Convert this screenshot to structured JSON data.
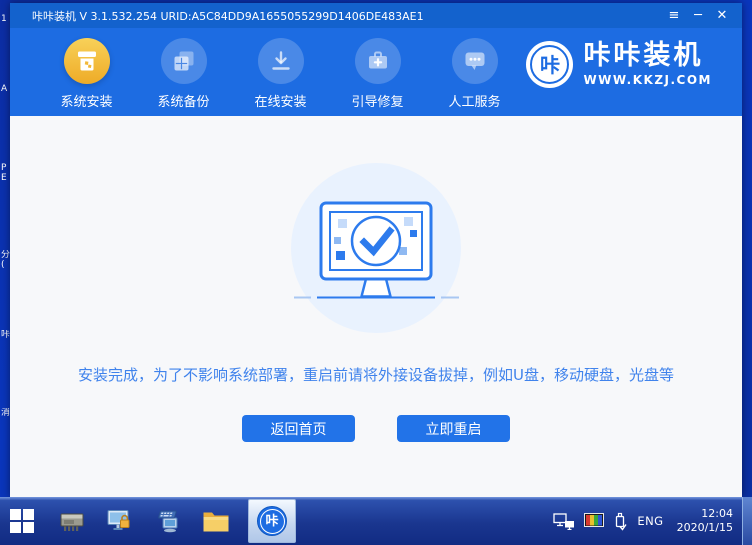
{
  "titlebar": {
    "title": "咔咔装机 V 3.1.532.254 URID:A5C84DD9A1655055299D1406DE483AE1",
    "menu_glyph": "≡",
    "minimize_glyph": "─",
    "close_glyph": "✕"
  },
  "nav": {
    "items": [
      {
        "label": "系统安装",
        "icon": "install-box-icon",
        "active": true
      },
      {
        "label": "系统备份",
        "icon": "backup-icon",
        "active": false
      },
      {
        "label": "在线安装",
        "icon": "online-download-icon",
        "active": false
      },
      {
        "label": "引导修复",
        "icon": "boot-repair-toolbox-icon",
        "active": false
      },
      {
        "label": "人工服务",
        "icon": "support-chat-icon",
        "active": false
      }
    ],
    "logo": {
      "symbol": "咔",
      "title": "咔咔装机",
      "url": "WWW.KKZJ.COM"
    }
  },
  "main": {
    "message": "安装完成，为了不影响系统部署，重启前请将外接设备拔掉，例如U盘，移动硬盘，光盘等",
    "home_button": "返回首页",
    "reboot_button": "立即重启"
  },
  "desktop": {
    "fragments": [
      "1",
      "A",
      "PE",
      "分(",
      "咔",
      "消"
    ]
  },
  "taskbar": {
    "kaka_symbol": "咔",
    "language": "ENG",
    "time": "12:04",
    "date": "2020/1/15"
  },
  "colors": {
    "titlebar_blue": "#1362cd",
    "nav_blue": "#1d6ce2",
    "active_gold": "#eeab27",
    "content_bg": "#f7f8fa",
    "illus_circle": "#e9f2fe",
    "illus_stroke": "#2d7bed",
    "message_blue": "#4083ec",
    "button_blue": "#2273e8",
    "desktop_blue": "#0a36bd"
  }
}
